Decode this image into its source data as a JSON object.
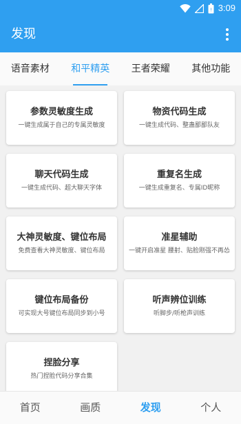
{
  "status_bar": {
    "time": "3:09"
  },
  "app_bar": {
    "title": "发现"
  },
  "tabs": [
    {
      "label": "语音素材"
    },
    {
      "label": "和平精英"
    },
    {
      "label": "王者荣耀"
    },
    {
      "label": "其他功能"
    }
  ],
  "active_tab": "和平精英",
  "cards": [
    {
      "title": "参数灵敏度生成",
      "subtitle": "一键生成属于自己的专属灵敏度"
    },
    {
      "title": "物资代码生成",
      "subtitle": "一键生成代码、整蛊鄙鄙队友"
    },
    {
      "title": "聊天代码生成",
      "subtitle": "一键生成代码、超大聊天字体"
    },
    {
      "title": "重复名生成",
      "subtitle": "一键生成重复名、专属ID昵称"
    },
    {
      "title": "大神灵敏度、键位布局",
      "subtitle": "免费查看大神灵敏度、键位布局"
    },
    {
      "title": "准星辅助",
      "subtitle": "一键开启准星 腰射、贴脸刚强不再怂"
    },
    {
      "title": "键位布局备份",
      "subtitle": "可实现大号键位布局同步到小号"
    },
    {
      "title": "听声辨位训练",
      "subtitle": "听脚步/听枪声训练"
    },
    {
      "title": "捏脸分享",
      "subtitle": "热门捏脸代码分享合集"
    }
  ],
  "bottom_nav": [
    {
      "label": "首页"
    },
    {
      "label": "画质"
    },
    {
      "label": "发现"
    },
    {
      "label": "个人"
    }
  ],
  "active_nav": "发现",
  "colors": {
    "primary": "#2f9ff0",
    "background": "#f1f1f1",
    "card": "#ffffff"
  },
  "icons": [
    "wifi-icon",
    "cell-signal-icon",
    "battery-icon",
    "more-vert-icon"
  ]
}
